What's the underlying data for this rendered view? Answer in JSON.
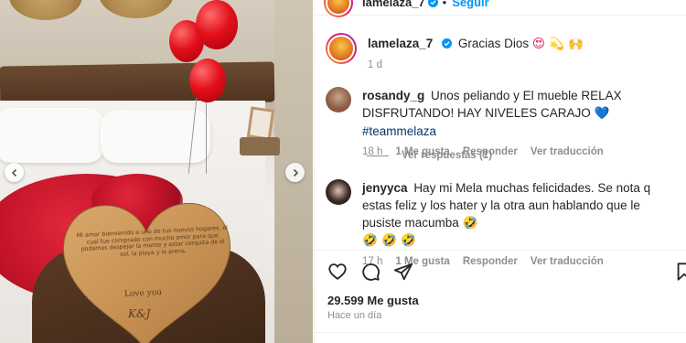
{
  "photo": {
    "heart_text": "Mi amor bienvenido a uno de tus nuevos hogares, el cual fue comprado con mucho amor para que podamos despejar la mente y estar cerquita de el sol, la playa y la arena.",
    "heart_love": "Love you",
    "heart_initials": "K&J"
  },
  "header": {
    "username": "lamelaza_7",
    "follow_label": "Seguir"
  },
  "caption": {
    "username": "lamelaza_7",
    "text": "Gracias Dios",
    "emoji": "😍 💫 🙌",
    "time": "1 d"
  },
  "comments": [
    {
      "username": "rosandy_g",
      "text": "Unos peliando y El mueble RELAX DISFRUTANDO! HAY NIVELES CARAJO",
      "emoji": "💙",
      "hashtag": "#teammelaza",
      "time": "18 h",
      "likes": "1 Me gusta",
      "reply": "Responder",
      "translate": "Ver traducción"
    },
    {
      "username": "jenyyca",
      "text": "Hay mi Mela muchas felicidades. Se nota q estas feliz y los hater y la otra aun hablando que le pusiste macumba",
      "emoji": "🤣",
      "emoji_line": "🤣 🤣 🤣",
      "time": "17 h",
      "likes": "1 Me gusta",
      "reply": "Responder",
      "translate": "Ver traducción"
    }
  ],
  "view_replies": "Ver respuestas (1)",
  "post": {
    "likes": "29.599 Me gusta",
    "ago": "Hace un día"
  },
  "colors": {
    "link": "#0095f6",
    "hashtag": "#00376b",
    "muted": "#8e8e8e",
    "text": "#262626"
  }
}
